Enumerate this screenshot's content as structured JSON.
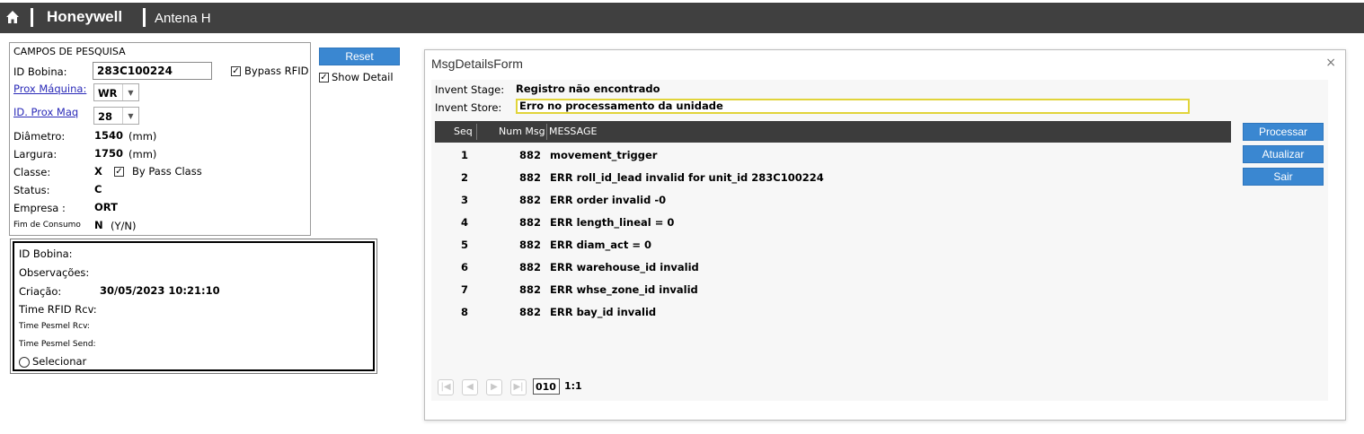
{
  "header": {
    "brand": "Honeywell",
    "subtitle": "Antena H",
    "icon": "home-icon"
  },
  "search": {
    "title": "CAMPOS DE PESQUISA",
    "id_bobina_label": "ID Bobina:",
    "id_bobina_value": "283C100224",
    "bypass_rfid_label": "Bypass RFID",
    "bypass_rfid_checked": true,
    "prox_maquina_label": "Prox Máquina:",
    "prox_maquina_value": "WR",
    "id_prox_maq_label": "ID. Prox Maq",
    "id_prox_maq_value": "28",
    "diametro_label": "Diâmetro:",
    "diametro_value": "1540",
    "diametro_unit": "(mm)",
    "largura_label": "Largura:",
    "largura_value": "1750",
    "largura_unit": "(mm)",
    "classe_label": "Classe:",
    "classe_value": "X",
    "bypass_class_label": "By Pass Class",
    "bypass_class_checked": true,
    "status_label": "Status:",
    "status_value": "C",
    "empresa_label": "Empresa :",
    "empresa_value": "ORT",
    "fim_consumo_label": "Fim de Consumo",
    "fim_consumo_value": "N",
    "fim_consumo_hint": "(Y/N)"
  },
  "actions": {
    "reset_label": "Reset",
    "show_detail_label": "Show Detail",
    "show_detail_checked": true
  },
  "info": {
    "id_bobina_label": "ID Bobina:",
    "observacoes_label": "Observações:",
    "criacao_label": "Criação:",
    "criacao_value": "30/05/2023 10:21:10",
    "time_rfid_label": "Time RFID Rcv:",
    "time_pesmel_rcv_label": "Time Pesmel Rcv:",
    "time_pesmel_send_label": "Time Pesmel Send:",
    "selecionar_label": "Selecionar"
  },
  "dialog": {
    "title": "MsgDetailsForm",
    "close": "×",
    "invent_stage_label": "Invent Stage:",
    "invent_stage_value": "Registro não encontrado",
    "invent_store_label": "Invent Store:",
    "invent_store_value": "Erro no processamento da unidade",
    "columns": [
      "Seq",
      "Num Msg",
      "MESSAGE"
    ],
    "rows": [
      {
        "seq": "1",
        "num": "882",
        "msg": "movement_trigger"
      },
      {
        "seq": "2",
        "num": "882",
        "msg": "ERR roll_id_lead invalid for unit_id 283C100224"
      },
      {
        "seq": "3",
        "num": "882",
        "msg": "ERR order invalid -0"
      },
      {
        "seq": "4",
        "num": "882",
        "msg": "ERR length_lineal = 0"
      },
      {
        "seq": "5",
        "num": "882",
        "msg": "ERR diam_act = 0"
      },
      {
        "seq": "6",
        "num": "882",
        "msg": "ERR warehouse_id invalid"
      },
      {
        "seq": "7",
        "num": "882",
        "msg": "ERR whse_zone_id invalid"
      },
      {
        "seq": "8",
        "num": "882",
        "msg": "ERR bay_id invalid"
      }
    ],
    "buttons": {
      "processar": "Processar",
      "atualizar": "Atualizar",
      "sair": "Sair"
    },
    "pager": {
      "page_size": "010",
      "position": "1:1"
    }
  },
  "colors": {
    "topbar": "#404040",
    "button": "#3a87d1",
    "grid_header": "#3c3c3c",
    "store_highlight": "#e1d43a",
    "link": "#2a2ab8"
  }
}
